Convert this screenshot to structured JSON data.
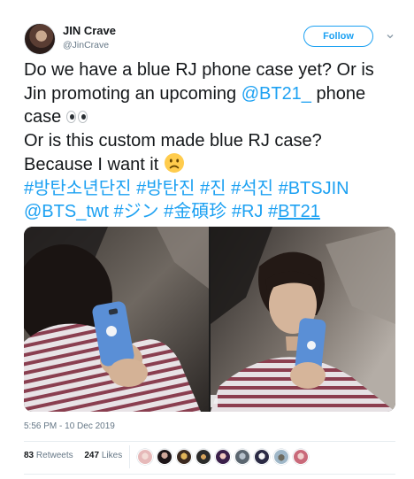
{
  "tweet": {
    "author_name": "JIN Crave",
    "author_handle": "@JinCrave",
    "follow_label": "Follow",
    "text": {
      "l1": "Do we have a blue RJ phone case yet? Or is",
      "l2_a": "Jin promoting an upcoming ",
      "l2_link": "@BT21_",
      "l2_b": " phone",
      "l3": "case ",
      "l4": "Or is this custom made blue RJ case?",
      "l5": "Because I want it ",
      "h1": "#방탄소년단진",
      "h2": "#방탄진",
      "h3": "#진",
      "h4": "#석진",
      "h5": "#BTSJIN",
      "h6": "@BTS_twt",
      "h7": "#ジン",
      "h8": "#金碩珍",
      "h9": "#RJ",
      "h10_hash": "#",
      "h10_word": "BT21"
    },
    "timestamp": "5:56 PM - 10 Dec 2019",
    "retweets_count": "83",
    "retweets_label": "Retweets",
    "likes_count": "247",
    "likes_label": "Likes",
    "icons": {
      "chevron": "chevron-down-icon",
      "eyes": "eyes-emoji-icon",
      "sad": "slightly-frowning-face-icon"
    },
    "colors": {
      "link": "#1da1f2",
      "text": "#14171a",
      "secondary": "#657786",
      "phone_case": "#5a8fd6"
    }
  }
}
